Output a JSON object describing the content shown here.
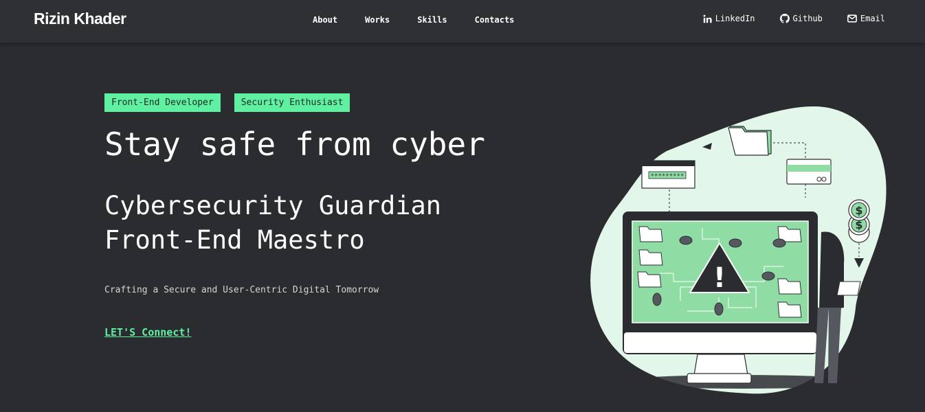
{
  "nav": {
    "logo": "Rizin Khader",
    "menu": [
      "About",
      "Works",
      "Skills",
      "Contacts"
    ],
    "social": [
      {
        "label": "LinkedIn",
        "icon": "linkedin-icon"
      },
      {
        "label": "Github",
        "icon": "github-icon"
      },
      {
        "label": "Email",
        "icon": "envelope-icon"
      }
    ]
  },
  "hero": {
    "tags": [
      "Front-End Developer",
      "Security Enthusiast"
    ],
    "title": "Stay safe from cyber",
    "subtitle_line1": "Cybersecurity Guardian",
    "subtitle_line2": "Front-End Maestro",
    "tagline": "Crafting a Secure and User-Centric Digital Tomorrow",
    "cta": "LET'S Connect!"
  },
  "illustration": {
    "password_mask": "*********",
    "alert_symbol": "!",
    "coin_symbol": "$"
  },
  "colors": {
    "accent": "#5ff0a1",
    "background": "#2b2c30",
    "nav_background": "#2e3034",
    "blob": "#e3f6ea",
    "screen": "#8fdca5"
  }
}
